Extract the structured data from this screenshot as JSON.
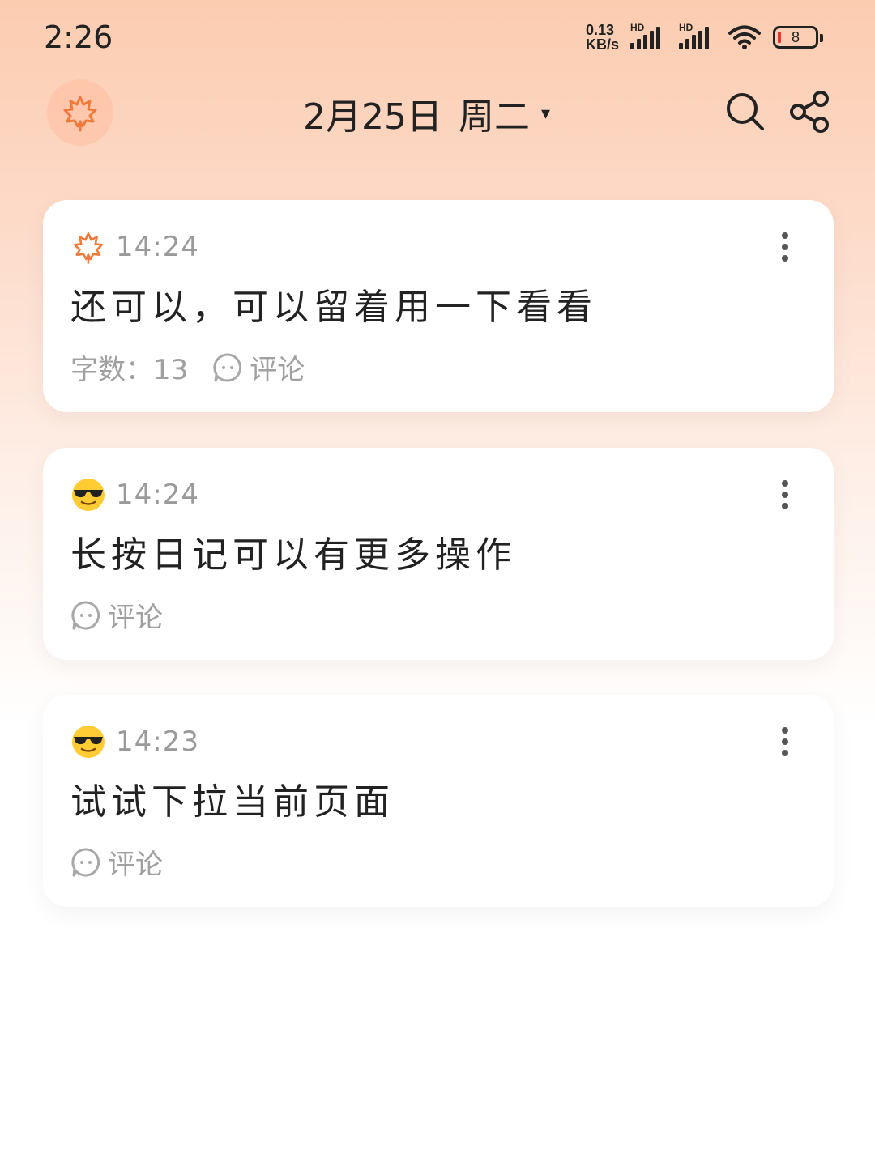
{
  "status_bar": {
    "time": "2:26",
    "net_speed_value": "0.13",
    "net_speed_unit": "KB/s",
    "signal_1_label": "HD",
    "signal_2_label": "HD",
    "battery_level": "8"
  },
  "header": {
    "date": "2月25日",
    "weekday": "周二",
    "caret": "▾"
  },
  "entries": [
    {
      "time": "14:24",
      "mood_icon": "maple-leaf-icon",
      "text": "还可以，可以留着用一下看看",
      "word_count_label": "字数：",
      "word_count": "13",
      "comment_label": "评论"
    },
    {
      "time": "14:24",
      "mood_icon": "sunglasses-emoji-icon",
      "text": "长按日记可以有更多操作",
      "comment_label": "评论"
    },
    {
      "time": "14:23",
      "mood_icon": "sunglasses-emoji-icon",
      "text": "试试下拉当前页面",
      "comment_label": "评论"
    }
  ],
  "colors": {
    "accent": "#ee7a3c",
    "text_primary": "#222222",
    "text_secondary": "#9a9a9a"
  }
}
